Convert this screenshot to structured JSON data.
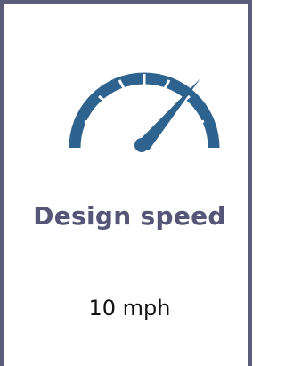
{
  "card": {
    "title": "Design speed",
    "value": "10 mph",
    "icon": "speedometer-icon"
  },
  "colors": {
    "border": "#5b5b7a",
    "gauge": "#2f638f",
    "title": "#555577",
    "value": "#111111"
  }
}
